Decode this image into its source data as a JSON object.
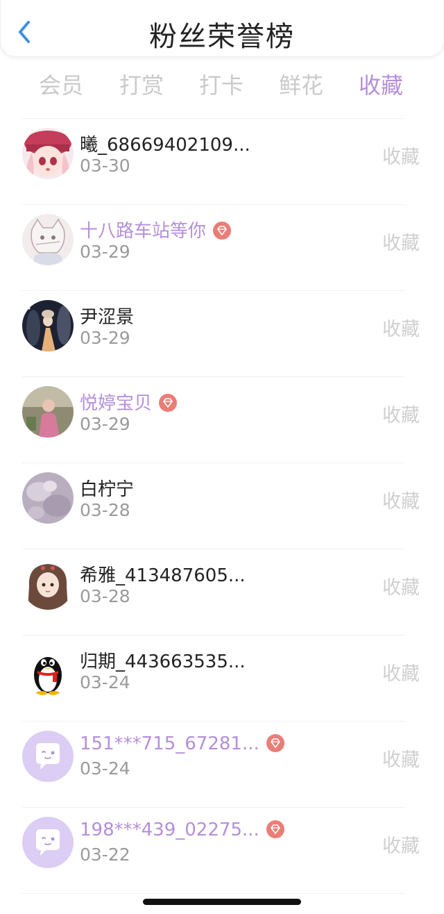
{
  "header": {
    "title": "粉丝荣誉榜"
  },
  "tabs": [
    {
      "label": "会员"
    },
    {
      "label": "打赏"
    },
    {
      "label": "打卡"
    },
    {
      "label": "鲜花"
    },
    {
      "label": "收藏",
      "active": true
    }
  ],
  "colors": {
    "accent": "#b58fd9",
    "gem": "#ea7d76",
    "muted": "#cfcfcf"
  },
  "fans": [
    {
      "name": "曦_68669402109...",
      "date": "03-30",
      "action": "收藏",
      "vip": false,
      "avatar": "anime-girl-red-hat"
    },
    {
      "name": "十八路车站等你",
      "date": "03-29",
      "action": "收藏",
      "vip": true,
      "avatar": "sketch-character"
    },
    {
      "name": "尹涩景",
      "date": "03-29",
      "action": "收藏",
      "vip": false,
      "avatar": "night-photo"
    },
    {
      "name": "悦婷宝贝",
      "date": "03-29",
      "action": "收藏",
      "vip": true,
      "avatar": "child-photo"
    },
    {
      "name": "白柠宁",
      "date": "03-28",
      "action": "收藏",
      "vip": false,
      "avatar": "lavender-texture"
    },
    {
      "name": "希雅_413487605...",
      "date": "03-28",
      "action": "收藏",
      "vip": false,
      "avatar": "drawn-girl"
    },
    {
      "name": "归期_443663535...",
      "date": "03-24",
      "action": "收藏",
      "vip": false,
      "avatar": "qq-penguin"
    },
    {
      "name": "151***715_67281...",
      "date": "03-24",
      "action": "收藏",
      "vip": true,
      "avatar": "chat-bubble-default"
    },
    {
      "name": "198***439_02275...",
      "date": "03-22",
      "action": "收藏",
      "vip": true,
      "avatar": "chat-bubble-default"
    }
  ]
}
